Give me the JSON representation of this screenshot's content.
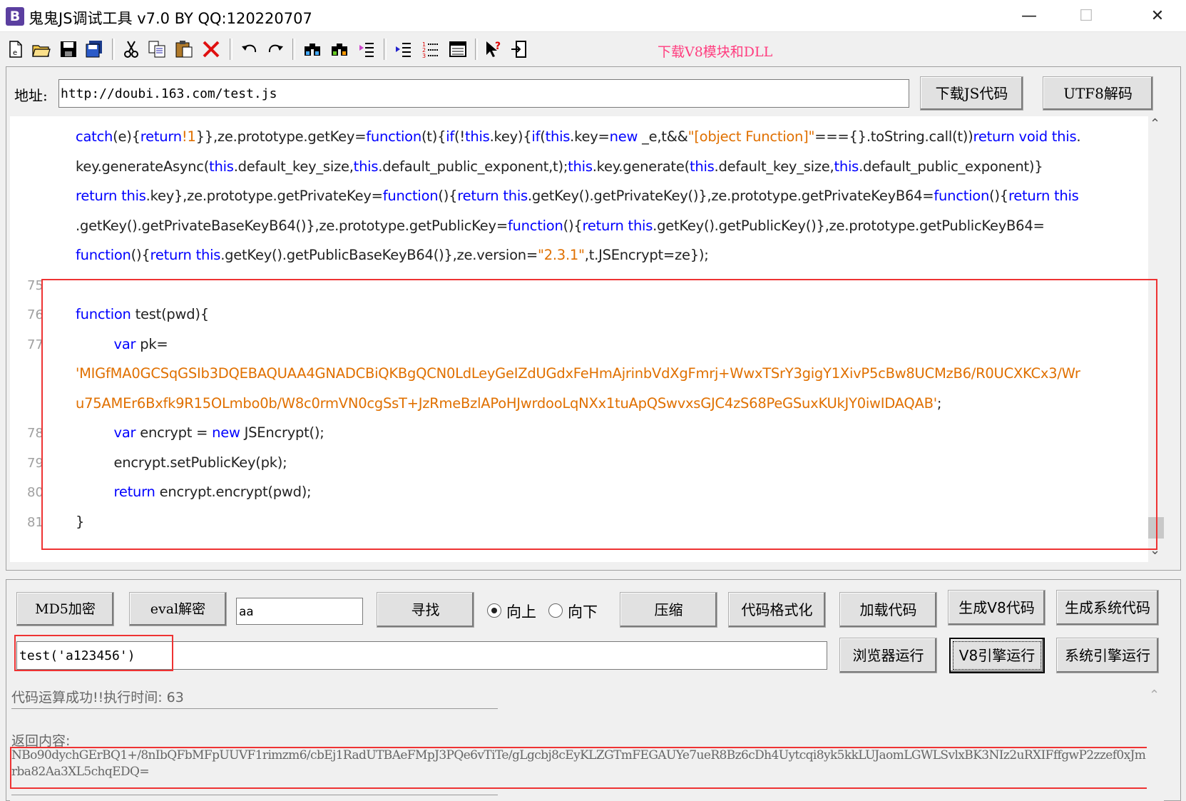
{
  "window": {
    "icon_letter": "B",
    "title": "鬼鬼JS调试工具 v7.0 BY QQ:120220707",
    "minimize": "—",
    "maximize": "☐",
    "close": "✕"
  },
  "toolbar": {
    "download_link": "下载V8模块和DLL",
    "icons": [
      "new-file-icon",
      "open-folder-icon",
      "save-icon",
      "save-all-icon",
      "cut-icon",
      "copy-icon",
      "paste-icon",
      "delete-icon",
      "undo-icon",
      "redo-icon",
      "find-icon",
      "find-next-icon",
      "replace-icon",
      "indent-icon",
      "numbered-list-icon",
      "window-icon",
      "help-cursor-icon",
      "exit-icon"
    ]
  },
  "address": {
    "label": "地址:",
    "value": "http://doubi.163.com/test.js",
    "download_button": "下载JS代码",
    "utf8_button": "UTF8解码"
  },
  "editor": {
    "lines": [
      {
        "num": "",
        "html": "<span class='kw'>catch</span>(e){<span class='kw'>return</span><span class='str'>!1</span>}},ze.prototype.getKey=<span class='kw'>function</span>(t){<span class='kw'>if</span>(!<span class='kw'>this</span>.key){<span class='kw'>if</span>(<span class='kw'>this</span>.key=<span class='kw'>new</span> _e,t&amp;&amp;<span class='str'>\"[object Function]\"</span>==={}.toString.call(t))<span class='kw'>return void this</span>."
      },
      {
        "num": "",
        "html": "key.generateAsync(<span class='kw'>this</span>.default_key_size,<span class='kw'>this</span>.default_public_exponent,t);<span class='kw'>this</span>.key.generate(<span class='kw'>this</span>.default_key_size,<span class='kw'>this</span>.default_public_exponent)}"
      },
      {
        "num": "",
        "html": "<span class='kw'>return this</span>.key},ze.prototype.getPrivateKey=<span class='kw'>function</span>(){<span class='kw'>return this</span>.getKey().getPrivateKey()},ze.prototype.getPrivateKeyB64=<span class='kw'>function</span>(){<span class='kw'>return this</span>"
      },
      {
        "num": "",
        "html": ".getKey().getPrivateBaseKeyB64()},ze.prototype.getPublicKey=<span class='kw'>function</span>(){<span class='kw'>return this</span>.getKey().getPublicKey()},ze.prototype.getPublicKeyB64="
      },
      {
        "num": "",
        "html": "<span class='kw'>function</span>(){<span class='kw'>return this</span>.getKey().getPublicBaseKeyB64()},ze.version=<span class='str'>\"2.3.1\"</span>,t.JSEncrypt=ze});"
      },
      {
        "num": "75",
        "html": ""
      },
      {
        "num": "76",
        "html": "<span class='kw'>function</span> test(pwd){"
      },
      {
        "num": "77",
        "html": "&nbsp;&nbsp;&nbsp;&nbsp;&nbsp;&nbsp;&nbsp;&nbsp;&nbsp;<span class='kw'>var</span> pk="
      },
      {
        "num": "",
        "html": "<span class='str'>'MIGfMA0GCSqGSIb3DQEBAQUAA4GNADCBiQKBgQCN0LdLeyGeIZdUGdxFeHmAjrinbVdXgFmrj+WwxTSrY3gigY1XivP5cBw8UCMzB6/R0UCXKCx3/Wr</span>"
      },
      {
        "num": "",
        "html": "<span class='str'>u75AMEr6Bxfk9R15OLmbo0b/W8c0rmVN0cgSsT+JzRmeBzlAPoHJwrdooLqNXx1tuApQSwvxsGJC4zS68PeGSuxKUkJY0iwIDAQAB'</span>;"
      },
      {
        "num": "78",
        "html": "&nbsp;&nbsp;&nbsp;&nbsp;&nbsp;&nbsp;&nbsp;&nbsp;&nbsp;<span class='kw'>var</span> encrypt = <span class='kw'>new</span> JSEncrypt();"
      },
      {
        "num": "79",
        "html": "&nbsp;&nbsp;&nbsp;&nbsp;&nbsp;&nbsp;&nbsp;&nbsp;&nbsp;encrypt.setPublicKey(pk);"
      },
      {
        "num": "80",
        "html": "&nbsp;&nbsp;&nbsp;&nbsp;&nbsp;&nbsp;&nbsp;&nbsp;&nbsp;<span class='kw'>return</span> encrypt.encrypt(pwd);"
      },
      {
        "num": "81",
        "html": "}"
      }
    ],
    "scroll_up": "⌃",
    "scroll_down": "⌄"
  },
  "controls": {
    "md5_button": "MD5加密",
    "eval_button": "eval解密",
    "search_value": "aa",
    "find_button": "寻找",
    "radio_up": "向上",
    "radio_down": "向下",
    "compress_button": "压缩",
    "format_button": "代码格式化",
    "load_button": "加载代码",
    "gen_v8_button": "生成V8代码",
    "gen_sys_button": "生成系统代码",
    "command_value": "test('a123456')",
    "browser_run_button": "浏览器运行",
    "v8_run_button": "V8引擎运行",
    "sys_run_button": "系统引擎运行"
  },
  "output": {
    "status": "代码运算成功!!执行时间: 63",
    "result_label": "返回内容:",
    "result_value": "NBo90dychGErBQ1+/8nIbQFbMFpUUVF1rimzm6/cbEj1RadUTBAeFMpJ3PQe6vTiTe/gLgcbj8cEyKLZGTmFEGAUYe7ueR8Bz6cDh4Uytcqi8yk5kkLUJaomLGWLSvlxBK3NIz2uRXIFffgwP2zzef0xJmrba82Aa3XL5chqEDQ="
  }
}
